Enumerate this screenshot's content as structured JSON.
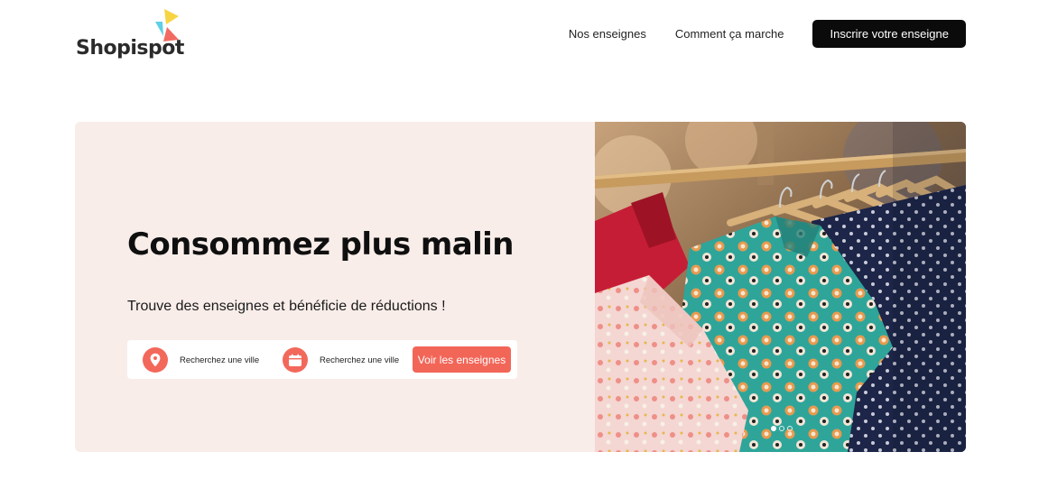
{
  "brand": {
    "name": "Shopispot",
    "colors": {
      "triangle_yellow": "#f7d443",
      "triangle_blue": "#5ed0e6",
      "triangle_coral": "#f26b63"
    }
  },
  "nav": {
    "links": [
      {
        "label": "Nos enseignes"
      },
      {
        "label": "Comment ça marche"
      }
    ],
    "cta_label": "Inscrire votre enseigne"
  },
  "hero": {
    "title": "Consommez plus malin",
    "subtitle": "Trouve des enseignes et bénéficie de réductions !",
    "search": {
      "city_label": "Recherchez une ville",
      "city_icon": "map-pin-icon",
      "date_label": "Recherchez une ville",
      "date_icon": "calendar-icon",
      "button_label": "Voir les enseignes"
    },
    "carousel": {
      "slides": 3,
      "active_index": 0
    },
    "colors": {
      "background": "#f8ede9",
      "accent": "#f26658"
    }
  }
}
